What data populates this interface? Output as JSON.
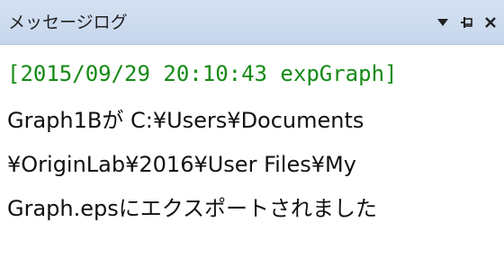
{
  "panel": {
    "title": "メッセージログ",
    "buttons": {
      "dropdown_icon": "triangle-down",
      "pin_icon": "pushpin",
      "close_icon": "x"
    }
  },
  "log": {
    "entry_header": "[2015/09/29 20:10:43 expGraph]",
    "lines": [
      "Graph1Bが C:¥Users¥Documents",
      "¥OriginLab¥2016¥User Files¥My",
      "Graph.epsにエクスポートされました"
    ]
  },
  "colors": {
    "titlebar": "#c9d8ee",
    "header_text": "#148a14",
    "body_text": "#111111"
  }
}
